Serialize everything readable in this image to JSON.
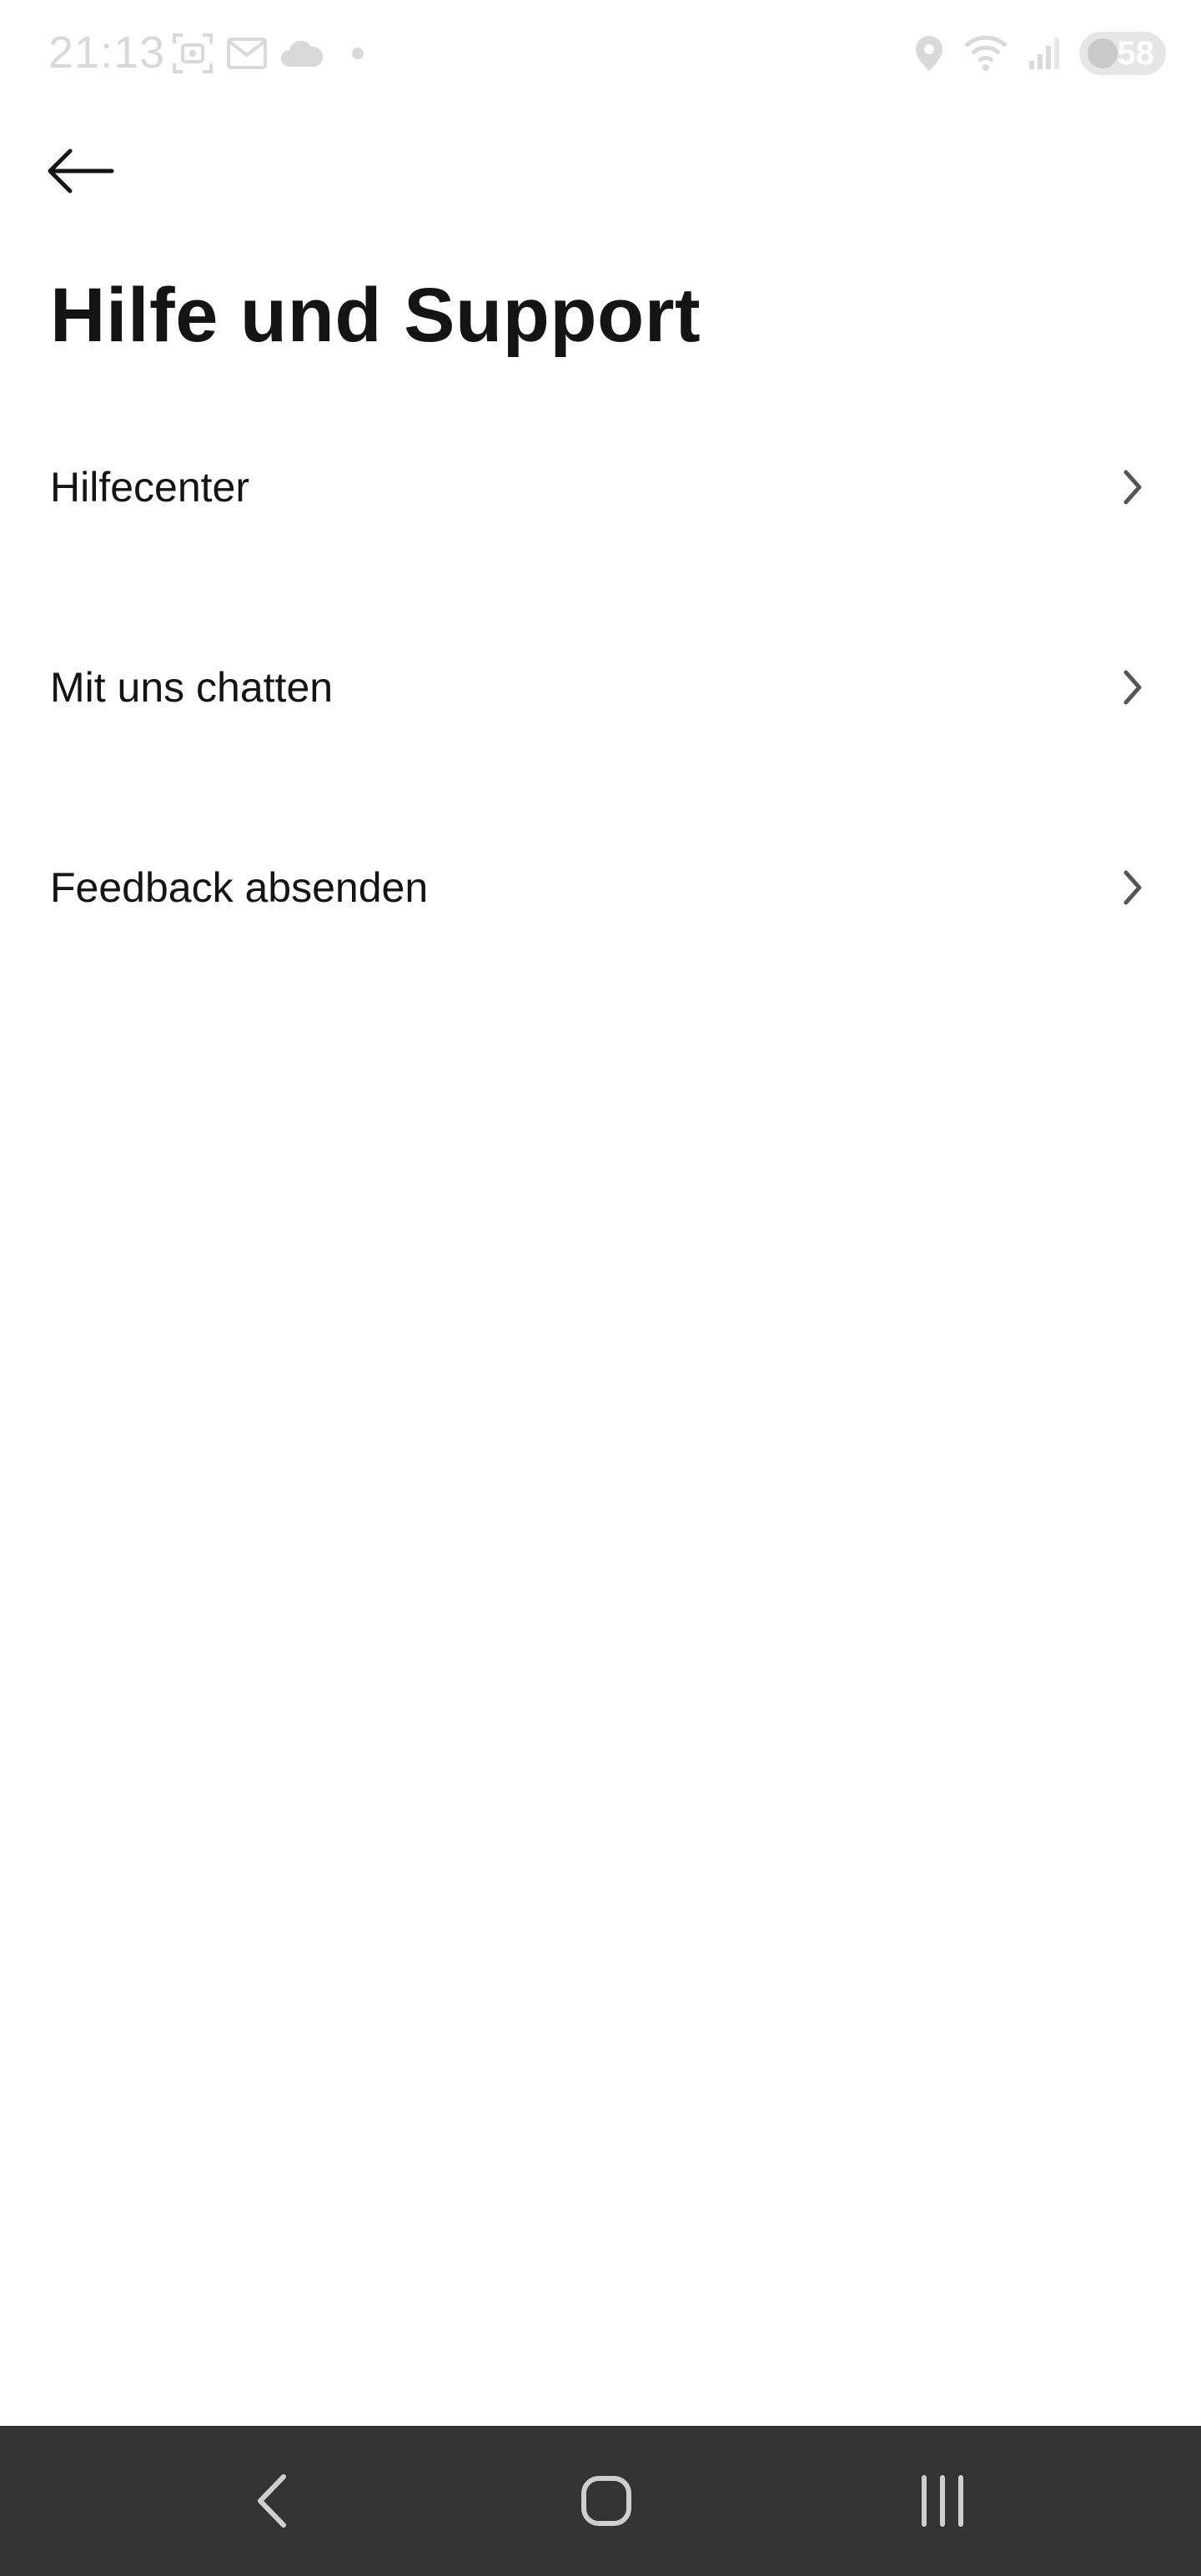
{
  "status_bar": {
    "time": "21:13",
    "battery_level": "58",
    "left_icons": [
      "screenshot-icon",
      "mail-icon",
      "cloud-icon",
      "dot-icon"
    ],
    "right_icons": [
      "location-icon",
      "wifi-icon",
      "signal-icon",
      "battery-icon"
    ]
  },
  "header": {
    "back_icon": "arrow-left-icon",
    "title": "Hilfe und Support"
  },
  "menu": {
    "items": [
      {
        "label": "Hilfecenter",
        "icon": "chevron-right-icon"
      },
      {
        "label": "Mit uns chatten",
        "icon": "chevron-right-icon"
      },
      {
        "label": "Feedback absenden",
        "icon": "chevron-right-icon"
      }
    ]
  },
  "nav_bar": {
    "buttons": [
      "nav-back-icon",
      "nav-home-icon",
      "nav-recent-apps-icon"
    ]
  },
  "colors": {
    "text": "#141414",
    "status_icons": "#d9d9d9",
    "chevron": "#555555",
    "nav_bar_bg": "#333333",
    "nav_icons": "#cfcfcf",
    "background": "#ffffff"
  }
}
